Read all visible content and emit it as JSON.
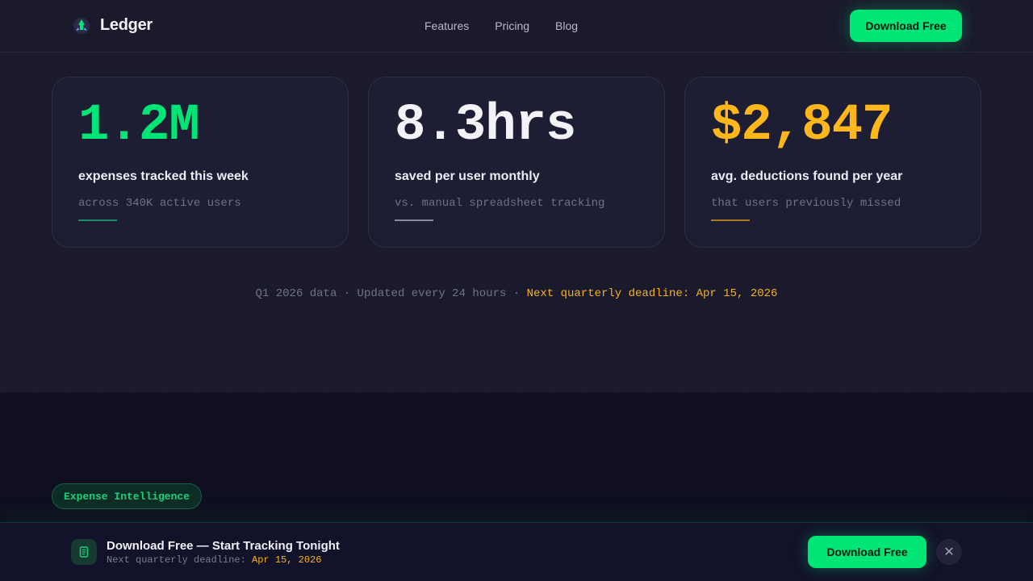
{
  "brand": {
    "name": "Ledger",
    "icon": "rocket-logo-icon"
  },
  "nav": {
    "links": [
      "Features",
      "Pricing",
      "Blog"
    ],
    "cta_label": "Download Free"
  },
  "stats": [
    {
      "value": "1.2M",
      "label": "expenses tracked this week",
      "sub": "across 340K active users",
      "color": "#00e676",
      "rule_color": "#1f8c70"
    },
    {
      "value": "8.3hrs",
      "label": "saved per user monthly",
      "sub": "vs. manual spreadsheet tracking",
      "color": "#f2f2f7",
      "rule_color": "#8a8a9c"
    },
    {
      "value": "$2,847",
      "label": "avg. deductions found per year",
      "sub": "that users previously missed",
      "color": "#ffb71b",
      "rule_color": "#a77c20"
    }
  ],
  "footnote": {
    "prefix": "Q1 2026 data · Updated every 24 hours · ",
    "highlight": "Next quarterly deadline: Apr 15, 2026"
  },
  "section_pill": "Expense Intelligence",
  "sticky_bar": {
    "icon": "document-icon",
    "title": "Download Free — Start Tracking Tonight",
    "sub_prefix": "Next quarterly deadline: ",
    "sub_highlight": "Apr 15, 2026",
    "cta_label": "Download Free",
    "close_icon": "close-icon"
  },
  "colors": {
    "accent": "#00e676",
    "warning": "#f5b21b",
    "background": "#1a1a2c"
  }
}
